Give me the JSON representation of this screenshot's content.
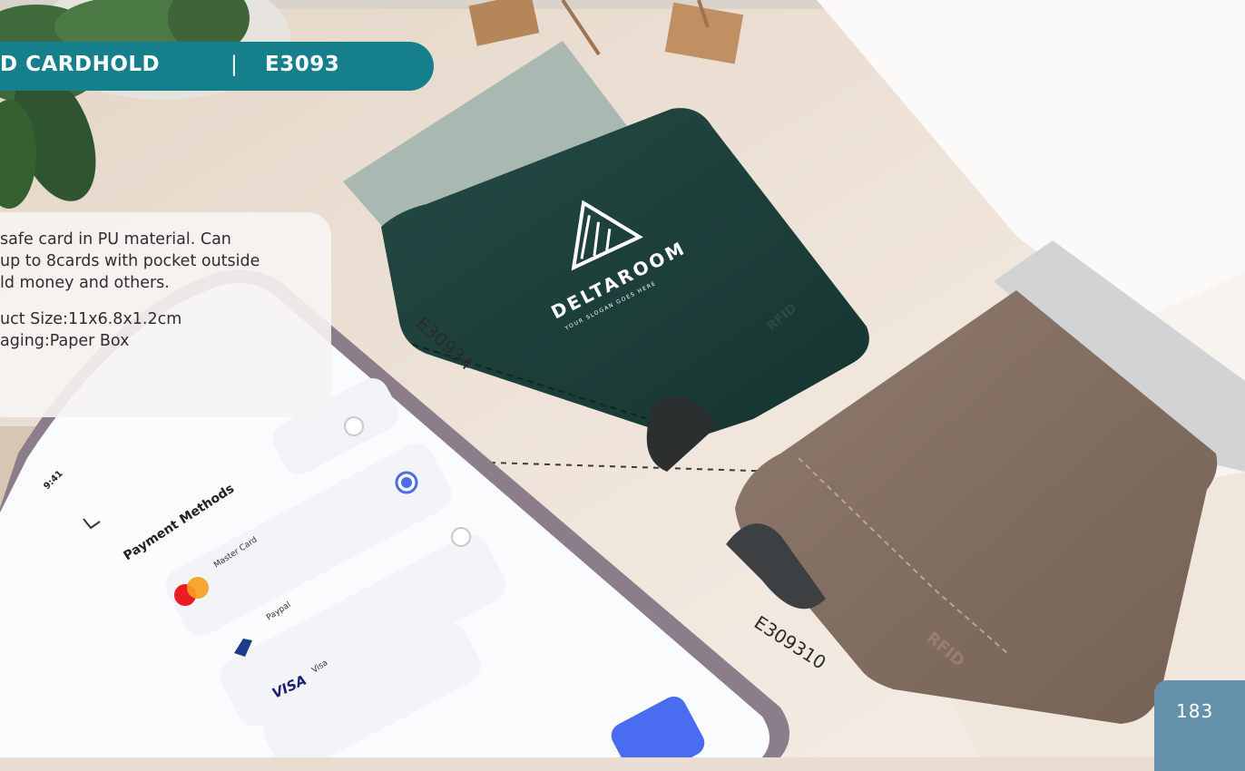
{
  "header": {
    "product_name": "D CARDHOLD",
    "separator": "|",
    "product_code": "E3093"
  },
  "description": {
    "lines": [
      "safe card in PU material.   Can",
      "up to 8cards with pocket outside",
      "ld money and others."
    ],
    "specs": [
      "uct Size:11x6.8x1.2cm",
      "aging:Paper Box"
    ]
  },
  "wallets": {
    "green": {
      "sku": "E30934",
      "brand": "DELTAROOM",
      "slogan": "YOUR SLOGAN GOES HERE",
      "rfid_mark": "RFID",
      "color": "#1f3d38",
      "band_color": "#a9b8b0"
    },
    "brown": {
      "sku": "E309310",
      "rfid_mark": "RFID",
      "color": "#8a7466",
      "band_color": "#d2d3d4"
    }
  },
  "phone": {
    "time": "9:41",
    "screen_title": "Payment Methods",
    "methods": [
      {
        "label": "",
        "selected": false
      },
      {
        "label": "Master Card",
        "selected": true
      },
      {
        "label": "Paypal",
        "selected": false
      },
      {
        "label": "Visa",
        "selected": false
      }
    ],
    "visa_logo": "VISA",
    "accent_color": "#4a6cf0"
  },
  "page": {
    "number": "183",
    "tab_color": "#6591ab"
  },
  "colors": {
    "header_bg": "#167f8c"
  }
}
